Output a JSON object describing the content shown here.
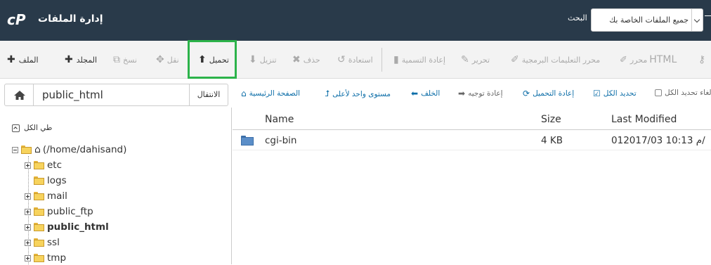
{
  "header": {
    "title": "إدارة الملفات",
    "search_label": "البحث",
    "search_scope": "جميع الملفات الخاصة بك"
  },
  "toolbar": {
    "file": "الملف",
    "folder": "المجلد",
    "copy": "نسخ",
    "move": "نقل",
    "upload": "تحميل",
    "download": "تنزيل",
    "delete": "حذف",
    "restore": "استعادة",
    "rename": "إعادة التسمية",
    "edit": "تحرير",
    "code_editor": "محرر التعليمات البرمجية",
    "html_editor_prefix": "HTML",
    "html_editor_suffix": "محرر"
  },
  "pathbar": {
    "path": "public_html",
    "go": "الانتقال"
  },
  "nav": {
    "home": "الصفحة الرئيسية",
    "up_one_level": "مستوى واحد لأعلى",
    "back": "الخلف",
    "forward": "إعادة توجيه",
    "reload": "إعادة التحميل",
    "select_all": "تحديد الكل",
    "deselect_all": "إلغاء تحديد الكل"
  },
  "tree": {
    "collapse_all": "طي الكل",
    "root": "(/home/dahisand)",
    "items": [
      {
        "label": "etc",
        "bold": false
      },
      {
        "label": "logs",
        "bold": false
      },
      {
        "label": "mail",
        "bold": false
      },
      {
        "label": "public_ftp",
        "bold": false
      },
      {
        "label": "public_html",
        "bold": true
      },
      {
        "label": "ssl",
        "bold": false
      },
      {
        "label": "tmp",
        "bold": false
      }
    ]
  },
  "table": {
    "columns": [
      "Name",
      "Size",
      "Last Modified"
    ],
    "rows": [
      {
        "name": "cgi-bin",
        "size": "4 KB",
        "modified": "01م 10:13 2017/03/"
      }
    ]
  }
}
